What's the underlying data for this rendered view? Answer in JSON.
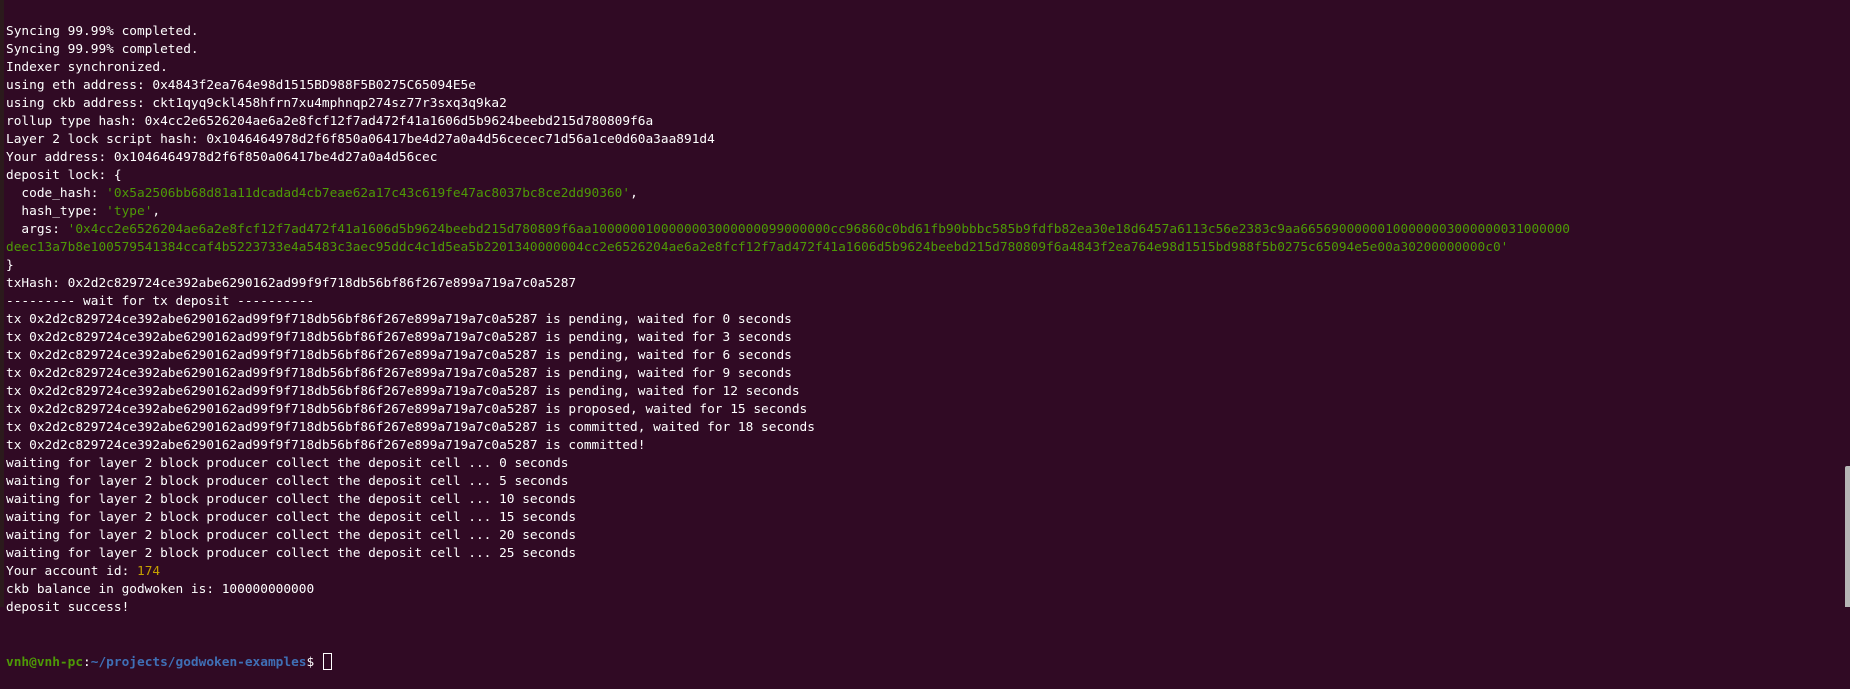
{
  "colors": {
    "background": "#300a24",
    "text": "#ffffff",
    "string": "#4e9a06",
    "number": "#c4a000",
    "prompt_user": "#4e9a06",
    "prompt_path": "#3f6fb5"
  },
  "terminal": {
    "lines": [
      [
        {
          "t": "Syncing 99.99% completed."
        }
      ],
      [
        {
          "t": "Syncing 99.99% completed."
        }
      ],
      [
        {
          "t": "Indexer synchronized."
        }
      ],
      [
        {
          "t": "using eth address: 0x4843f2ea764e98d1515BD988F5B0275C65094E5e"
        }
      ],
      [
        {
          "t": "using ckb address: ckt1qyq9ckl458hfrn7xu4mphnqp274sz77r3sxq3q9ka2"
        }
      ],
      [
        {
          "t": "rollup type hash: 0x4cc2e6526204ae6a2e8fcf12f7ad472f41a1606d5b9624beebd215d780809f6a"
        }
      ],
      [
        {
          "t": "Layer 2 lock script hash: 0x1046464978d2f6f850a06417be4d27a0a4d56cecec71d56a1ce0d60a3aa891d4"
        }
      ],
      [
        {
          "t": "Your address: 0x1046464978d2f6f850a06417be4d27a0a4d56cec"
        }
      ],
      [
        {
          "t": "deposit lock: {"
        }
      ],
      [
        {
          "t": "  code_hash: "
        },
        {
          "t": "'0x5a2506bb68d81a11dcadad4cb7eae62a17c43c619fe47ac8037bc8ce2dd90360'",
          "c": "green"
        },
        {
          "t": ","
        }
      ],
      [
        {
          "t": "  hash_type: "
        },
        {
          "t": "'type'",
          "c": "green"
        },
        {
          "t": ","
        }
      ],
      [
        {
          "t": "  args: "
        },
        {
          "t": "'0x4cc2e6526204ae6a2e8fcf12f7ad472f41a1606d5b9624beebd215d780809f6aa1000000100000003000000099000000cc96860c0bd61fb90bbbc585b9fdfb82ea30e18d6457a6113c56e2383c9aa66569000000100000003000000031000000",
          "c": "green"
        }
      ],
      [
        {
          "t": "deec13a7b8e100579541384ccaf4b5223733e4a5483c3aec95ddc4c1d5ea5b2201340000004cc2e6526204ae6a2e8fcf12f7ad472f41a1606d5b9624beebd215d780809f6a4843f2ea764e98d1515bd988f5b0275c65094e5e00a30200000000c0'",
          "c": "green"
        }
      ],
      [
        {
          "t": "}"
        }
      ],
      [
        {
          "t": "txHash: 0x2d2c829724ce392abe6290162ad99f9f718db56bf86f267e899a719a7c0a5287"
        }
      ],
      [
        {
          "t": "--------- wait for tx deposit ----------"
        }
      ],
      [
        {
          "t": "tx 0x2d2c829724ce392abe6290162ad99f9f718db56bf86f267e899a719a7c0a5287 is pending, waited for 0 seconds"
        }
      ],
      [
        {
          "t": "tx 0x2d2c829724ce392abe6290162ad99f9f718db56bf86f267e899a719a7c0a5287 is pending, waited for 3 seconds"
        }
      ],
      [
        {
          "t": "tx 0x2d2c829724ce392abe6290162ad99f9f718db56bf86f267e899a719a7c0a5287 is pending, waited for 6 seconds"
        }
      ],
      [
        {
          "t": "tx 0x2d2c829724ce392abe6290162ad99f9f718db56bf86f267e899a719a7c0a5287 is pending, waited for 9 seconds"
        }
      ],
      [
        {
          "t": "tx 0x2d2c829724ce392abe6290162ad99f9f718db56bf86f267e899a719a7c0a5287 is pending, waited for 12 seconds"
        }
      ],
      [
        {
          "t": "tx 0x2d2c829724ce392abe6290162ad99f9f718db56bf86f267e899a719a7c0a5287 is proposed, waited for 15 seconds"
        }
      ],
      [
        {
          "t": "tx 0x2d2c829724ce392abe6290162ad99f9f718db56bf86f267e899a719a7c0a5287 is committed, waited for 18 seconds"
        }
      ],
      [
        {
          "t": "tx 0x2d2c829724ce392abe6290162ad99f9f718db56bf86f267e899a719a7c0a5287 is committed!"
        }
      ],
      [
        {
          "t": "waiting for layer 2 block producer collect the deposit cell ... 0 seconds"
        }
      ],
      [
        {
          "t": "waiting for layer 2 block producer collect the deposit cell ... 5 seconds"
        }
      ],
      [
        {
          "t": "waiting for layer 2 block producer collect the deposit cell ... 10 seconds"
        }
      ],
      [
        {
          "t": "waiting for layer 2 block producer collect the deposit cell ... 15 seconds"
        }
      ],
      [
        {
          "t": "waiting for layer 2 block producer collect the deposit cell ... 20 seconds"
        }
      ],
      [
        {
          "t": "waiting for layer 2 block producer collect the deposit cell ... 25 seconds"
        }
      ],
      [
        {
          "t": "Your account id: "
        },
        {
          "t": "174",
          "c": "yellow"
        }
      ],
      [
        {
          "t": "ckb balance in godwoken is: 100000000000"
        }
      ],
      [
        {
          "t": "deposit success!"
        }
      ]
    ],
    "prompt": {
      "user_host": "vnh@vnh-pc",
      "separator": ":",
      "path": "~/projects/godwoken-examples",
      "symbol": "$ "
    }
  }
}
